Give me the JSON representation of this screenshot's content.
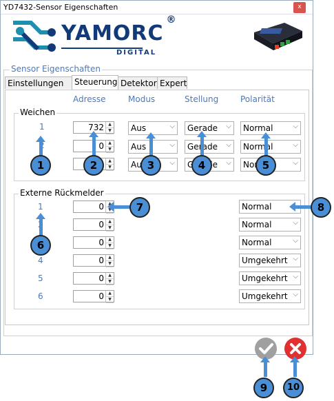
{
  "window": {
    "title": "YD7432-Sensor Eigenschaften",
    "close_label": "x"
  },
  "logo": {
    "name": "YAMORC",
    "registered": "®",
    "sub": "DIGITAL"
  },
  "group_title": "Sensor Eigenschaften",
  "tabs": [
    {
      "label": "Einstellungen",
      "active": false
    },
    {
      "label": "Steuerung",
      "active": true
    },
    {
      "label": "Detektor",
      "active": false
    },
    {
      "label": "Expert",
      "active": false
    }
  ],
  "columns": {
    "adresse": "Adresse",
    "modus": "Modus",
    "stellung": "Stellung",
    "polaritaet": "Polarität"
  },
  "weichen": {
    "label": "Weichen",
    "rows": [
      {
        "num": "1",
        "adresse": "732",
        "modus": "Aus",
        "stellung": "Gerade",
        "polaritaet": "Normal"
      },
      {
        "num": "2",
        "adresse": "0",
        "modus": "Aus",
        "stellung": "Gerade",
        "polaritaet": "Normal"
      },
      {
        "num": "3",
        "adresse": "0",
        "modus": "Aus",
        "stellung": "Gerade",
        "polaritaet": "Normal"
      }
    ]
  },
  "extern": {
    "label": "Externe Rückmelder",
    "rows": [
      {
        "num": "1",
        "adresse": "0",
        "polaritaet": "Normal"
      },
      {
        "num": "2",
        "adresse": "0",
        "polaritaet": "Normal"
      },
      {
        "num": "3",
        "adresse": "0",
        "polaritaet": "Normal"
      },
      {
        "num": "4",
        "adresse": "0",
        "polaritaet": "Umgekehrt"
      },
      {
        "num": "5",
        "adresse": "0",
        "polaritaet": "Umgekehrt"
      },
      {
        "num": "6",
        "adresse": "0",
        "polaritaet": "Umgekehrt"
      }
    ]
  },
  "badges": [
    "1",
    "2",
    "3",
    "4",
    "5",
    "6",
    "7",
    "8",
    "9",
    "10"
  ],
  "colors": {
    "accent": "#4a78c2",
    "badge": "#4a8fd6",
    "ok": "#a0a0a0",
    "cancel": "#e03030"
  }
}
